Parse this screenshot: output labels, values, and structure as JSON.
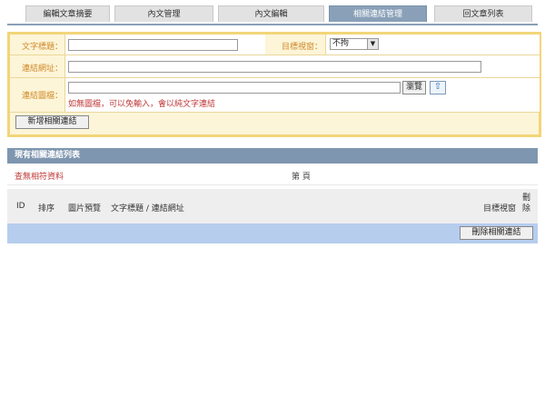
{
  "tabs": [
    {
      "label": "編輯文章摘要"
    },
    {
      "label": "內文管理"
    },
    {
      "label": "內文編輯"
    },
    {
      "label": "相關連結管理"
    },
    {
      "label": "回文章列表"
    }
  ],
  "form": {
    "title_label": "文字標題：",
    "title_value": "",
    "target_label": "目標視窗：",
    "target_selected": "不拘",
    "url_label": "連結網址：",
    "url_value": "",
    "image_label": "連結圖檔：",
    "image_value": "",
    "browse_label": "瀏覽",
    "hint": "如無圖檔，可以免輸入，會以純文字連結",
    "add_button": "新增相關連結"
  },
  "list": {
    "header": "現有相關連結列表",
    "no_data": "查無相符資料",
    "page_label": "第 頁",
    "columns": {
      "id": "ID",
      "order": "排序",
      "preview": "圖片預覽",
      "title_url": "文字標題 / 連結網址",
      "target": "目標視窗",
      "delete": "刪除"
    },
    "delete_button": "刪除相關連結"
  },
  "colors": {
    "tab_active": "#8aa0b8",
    "form_bg": "#fdf5d8",
    "form_border": "#f2d57a",
    "label": "#d08a2a",
    "hint": "#c03a3a",
    "list_header": "#7f96b0",
    "action_bar": "#b6cdee"
  }
}
